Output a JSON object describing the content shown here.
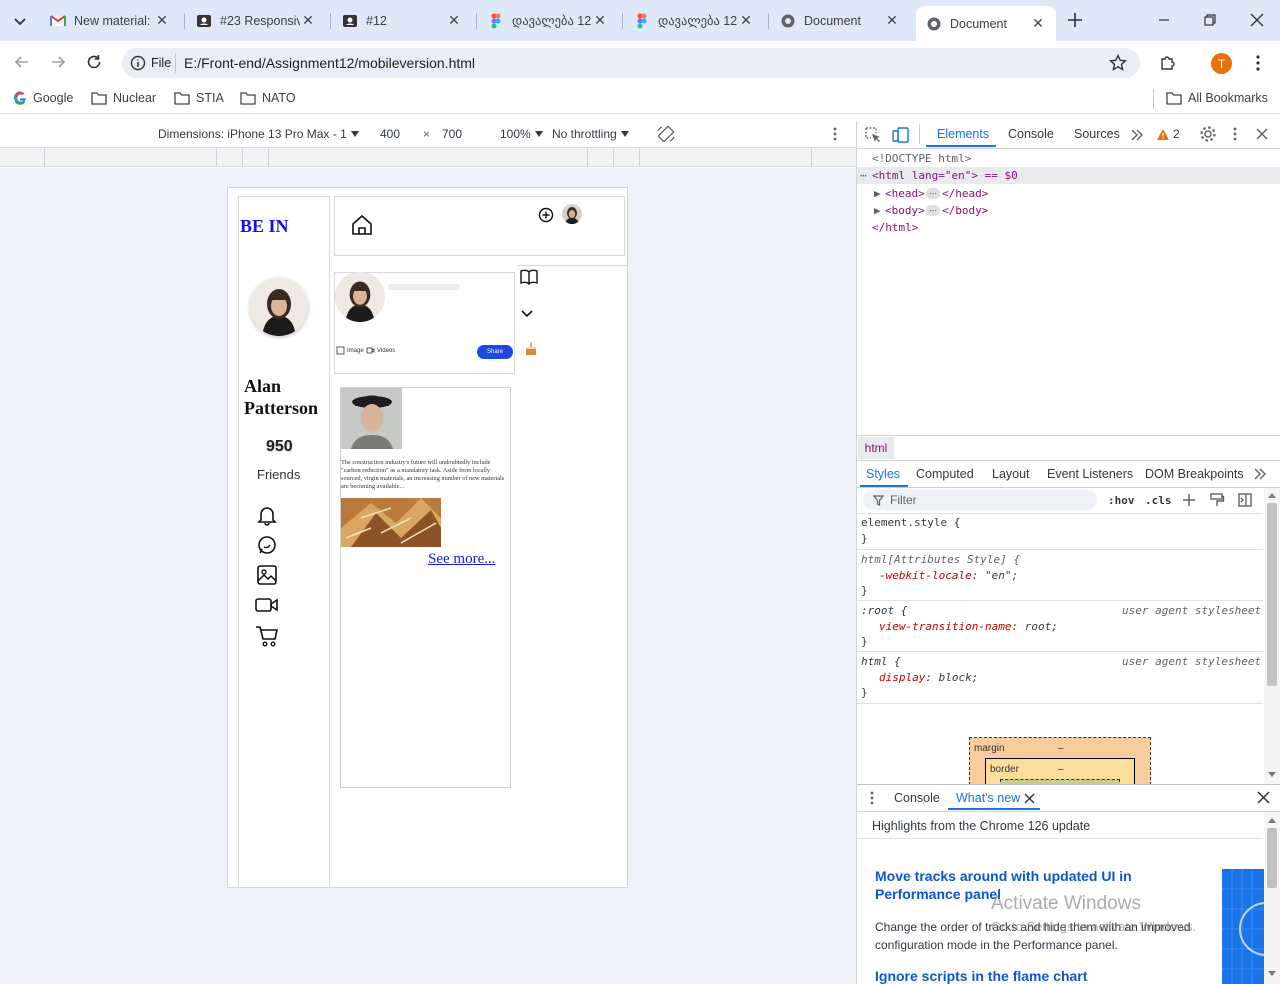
{
  "tabs": [
    {
      "title": "New material:",
      "icon": "gmail-icon"
    },
    {
      "title": "#23 Responsiv",
      "icon": "portfolio-icon"
    },
    {
      "title": "#12",
      "icon": "portfolio-icon"
    },
    {
      "title": "დავალება 12",
      "icon": "figma-icon"
    },
    {
      "title": "დავალება 12",
      "icon": "figma-icon"
    },
    {
      "title": "Document",
      "icon": "globe-icon"
    },
    {
      "title": "Document",
      "icon": "globe-icon",
      "active": true
    }
  ],
  "address": {
    "scheme_label": "File",
    "url": "E:/Front-end/Assignment12/mobileversion.html"
  },
  "profile_initial": "T",
  "bookmarks": [
    "Google",
    "Nuclear",
    "STIA",
    "NATO"
  ],
  "all_bookmarks": "All Bookmarks",
  "device": {
    "label": "Dimensions: iPhone 13 Pro Max - 1",
    "width": "400",
    "times": "×",
    "height": "700",
    "zoom": "100%",
    "throttle": "No throttling"
  },
  "site": {
    "brand": "BE IN",
    "name": "Alan Patterson",
    "friends_count": "950",
    "friends_label": "Friends",
    "composer_image": "Image",
    "composer_videos": "Videos",
    "share_label": "Share",
    "post_text": "The construction industry's future will undoubtedly include \"carbon reduction\" as a mandatory task. Aside from locally sourced, virgin materials, an increasing number of new materials are becoming available...",
    "see_more": "See more..."
  },
  "devtools": {
    "tabs": [
      "Elements",
      "Console",
      "Sources"
    ],
    "warn_count": "2",
    "dom": [
      "<!DOCTYPE html>",
      "<html lang=\"en\"> == $0",
      "<head>",
      "</head>",
      "<body>",
      "</body>",
      "</html>"
    ],
    "breadcrumb": "html",
    "style_tabs": [
      "Styles",
      "Computed",
      "Layout",
      "Event Listeners",
      "DOM Breakpoints"
    ],
    "filter_placeholder": "Filter",
    "hov": ":hov",
    "cls": ".cls",
    "rules": [
      {
        "selector": "element.style {",
        "decls": [],
        "source": ""
      },
      {
        "selector": "html[Attributes Style] {",
        "decls": [
          {
            "p": "-webkit-locale",
            "v": "\"en\";"
          }
        ],
        "source": ""
      },
      {
        "selector": ":root {",
        "decls": [
          {
            "p": "view-transition-name",
            "v": "root;"
          }
        ],
        "source": "user agent stylesheet"
      },
      {
        "selector": "html {",
        "decls": [
          {
            "p": "display",
            "v": "block;"
          }
        ],
        "source": "user agent stylesheet"
      }
    ],
    "boxmodel": {
      "margin": "margin",
      "border": "border",
      "dash": "–"
    },
    "drawer": {
      "tabs": [
        "Console",
        "What's new"
      ],
      "highlight": "Highlights from the Chrome 126 update",
      "article1_title": "Move tracks around with updated UI in Performance panel",
      "article1_body": "Change the order of tracks and hide them with an improved configuration mode in the Performance panel.",
      "article2_title": "Ignore scripts in the flame chart"
    }
  },
  "watermark": {
    "line1": "Activate Windows",
    "line2": "Go to Settings to activate Windows."
  }
}
